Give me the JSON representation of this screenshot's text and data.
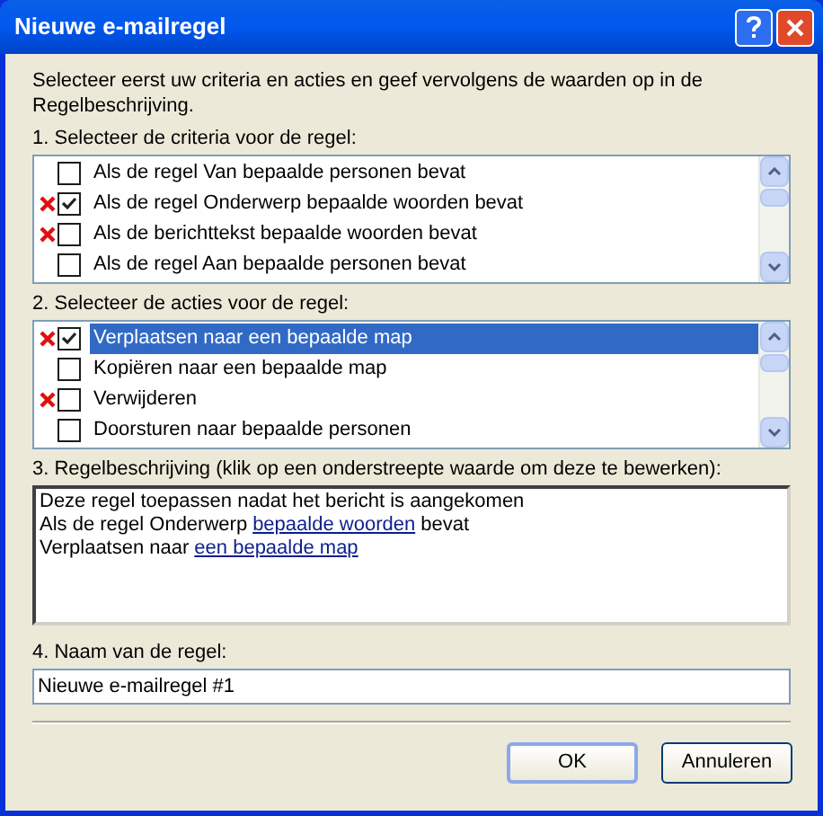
{
  "window": {
    "title": "Nieuwe e-mailregel"
  },
  "intro": "Selecteer eerst uw criteria en acties en geef vervolgens de waarden op in de Regelbeschrijving.",
  "criteria": {
    "label": "1. Selecteer de criteria voor de regel:",
    "items": [
      {
        "text": "Als de regel Van bepaalde personen bevat",
        "checked": false,
        "marked": false,
        "selected": false
      },
      {
        "text": "Als de regel Onderwerp bepaalde woorden bevat",
        "checked": true,
        "marked": true,
        "selected": false
      },
      {
        "text": "Als de berichttekst bepaalde woorden bevat",
        "checked": false,
        "marked": true,
        "selected": false
      },
      {
        "text": "Als de regel Aan bepaalde personen bevat",
        "checked": false,
        "marked": false,
        "selected": false
      }
    ]
  },
  "actions": {
    "label": "2. Selecteer de acties voor de regel:",
    "items": [
      {
        "text": "Verplaatsen naar een bepaalde map",
        "checked": true,
        "marked": true,
        "selected": true
      },
      {
        "text": "Kopiëren naar een bepaalde map",
        "checked": false,
        "marked": false,
        "selected": false
      },
      {
        "text": "Verwijderen",
        "checked": false,
        "marked": true,
        "selected": false
      },
      {
        "text": "Doorsturen naar bepaalde personen",
        "checked": false,
        "marked": false,
        "selected": false
      }
    ]
  },
  "description": {
    "label": "3. Regelbeschrijving (klik op een onderstreepte waarde om deze te bewerken):",
    "lines": [
      [
        {
          "kind": "text",
          "text": "Deze regel toepassen nadat het bericht is aangekomen"
        }
      ],
      [
        {
          "kind": "text",
          "text": "Als de regel Onderwerp"
        },
        {
          "kind": "link",
          "text": "bepaalde woorden"
        },
        {
          "kind": "text",
          "text": "bevat"
        }
      ],
      [
        {
          "kind": "text",
          "text": "Verplaatsen naar"
        },
        {
          "kind": "link",
          "text": "een bepaalde map"
        }
      ]
    ]
  },
  "name": {
    "label": "4. Naam van de regel:",
    "value": "Nieuwe e-mailregel #1"
  },
  "buttons": [
    {
      "label": "OK",
      "default": true
    },
    {
      "label": "Annuleren",
      "default": false
    }
  ]
}
